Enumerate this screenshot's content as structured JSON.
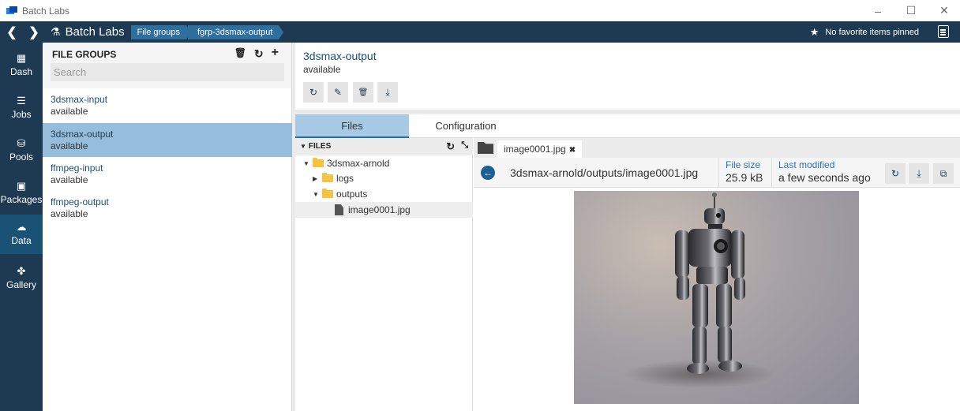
{
  "window": {
    "title": "Batch Labs",
    "minimize_glyph": "–",
    "maximize_glyph": "☐",
    "close_glyph": "✕"
  },
  "navbar": {
    "back_glyph": "❮",
    "forward_glyph": "❯",
    "brand": "Batch Labs",
    "brand_icon": "⚗",
    "breadcrumbs": [
      "File groups",
      "fgrp-3dsmax-output"
    ],
    "favorites_icon": "★",
    "favorites_text": "No favorite items pinned"
  },
  "rail": {
    "items": [
      {
        "label": "Dash",
        "icon": "▦"
      },
      {
        "label": "Jobs",
        "icon": "☰"
      },
      {
        "label": "Pools",
        "icon": "⛁"
      },
      {
        "label": "Packages",
        "icon": "▣"
      },
      {
        "label": "Data",
        "icon": "☁"
      },
      {
        "label": "Gallery",
        "icon": "✤"
      }
    ],
    "active": "Data"
  },
  "groups": {
    "title": "FILE GROUPS",
    "delete_icon": "🗑",
    "refresh_icon": "↻",
    "add_icon": "+",
    "search_placeholder": "Search",
    "items": [
      {
        "name": "3dsmax-input",
        "state": "available"
      },
      {
        "name": "3dsmax-output",
        "state": "available"
      },
      {
        "name": "ffmpeg-input",
        "state": "available"
      },
      {
        "name": "ffmpeg-output",
        "state": "available"
      }
    ],
    "selected": "3dsmax-output"
  },
  "detail": {
    "name": "3dsmax-output",
    "state": "available",
    "toolbar_icons": [
      "↻",
      "✎",
      "🗑",
      "⤓"
    ]
  },
  "tabs": [
    {
      "label": "Files"
    },
    {
      "label": "Configuration"
    }
  ],
  "tree": {
    "title": "FILES",
    "title_caret": "▼",
    "refresh_icon": "↻",
    "collapse_icon": "⤡",
    "nodes": [
      {
        "label": "3dsmax-arnold",
        "caret": "▼"
      },
      {
        "label": "logs",
        "caret": "▶"
      },
      {
        "label": "outputs",
        "caret": "▼"
      },
      {
        "label": "image0001.jpg",
        "caret": ""
      }
    ]
  },
  "viewer": {
    "tab_label": "image0001.jpg",
    "tab_close": "✖",
    "back_icon": "←",
    "path": "3dsmax-arnold/outputs/image0001.jpg",
    "file_size_label": "File size",
    "file_size_value": "25.9 kB",
    "modified_label": "Last modified",
    "modified_value": "a few seconds ago",
    "action_icons": [
      "↻",
      "⤓",
      "⧉"
    ]
  }
}
